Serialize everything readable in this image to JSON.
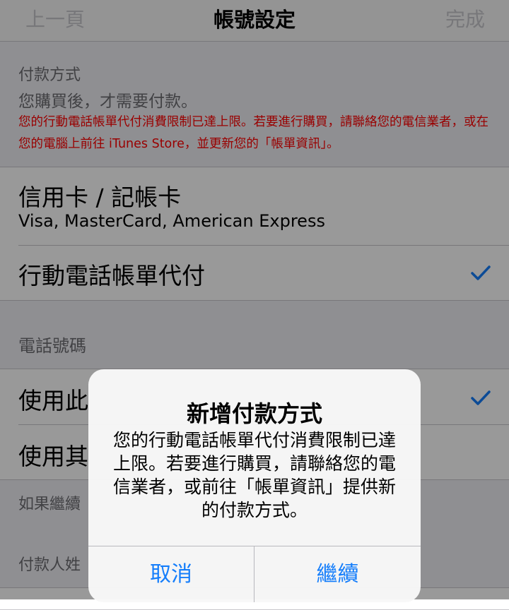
{
  "nav": {
    "back_label": "上一頁",
    "title": "帳號設定",
    "done_label": "完成"
  },
  "payment": {
    "section_title": "付款方式",
    "subtitle": "您購買後，才需要付款。",
    "warning": "您的行動電話帳單代付消費限制已達上限。若要進行購買，請聯絡您的電信業者，或在您的電腦上前往 iTunes Store，並更新您的「帳單資訊」。",
    "options": [
      {
        "title": "信用卡 / 記帳卡",
        "subtitle": "Visa, MasterCard, American Express",
        "selected": false
      },
      {
        "title": "行動電話帳單代付",
        "selected": true
      }
    ]
  },
  "phone": {
    "section_title": "電話號碼",
    "options": [
      {
        "title": "使用此",
        "selected": true
      },
      {
        "title": "使用其",
        "selected": false
      }
    ],
    "footer": "如果繼續"
  },
  "payer": {
    "section_title": "付款人姓"
  },
  "alert": {
    "title": "新增付款方式",
    "message": "您的行動電話帳單代付消費限制已達上限。若要進行購買，請聯絡您的電信業者，或前往「帳單資訊」提供新的付款方式。",
    "cancel_label": "取消",
    "continue_label": "繼續"
  },
  "colors": {
    "tint": "#157efb",
    "warning": "#ff0000",
    "background": "#efeff4"
  },
  "icons": {
    "check": "checkmark-icon"
  }
}
